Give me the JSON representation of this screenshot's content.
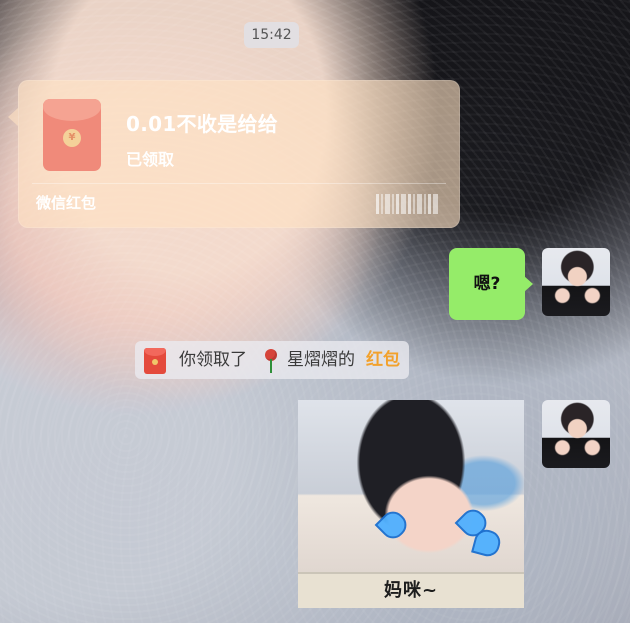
{
  "chat": {
    "timestamp": "15:42",
    "red_packet_card": {
      "title": "0.01不收是给给",
      "status": "已领取",
      "footer_label": "微信红包"
    },
    "messages": [
      {
        "type": "text",
        "text": "嗯?"
      },
      {
        "type": "system_notice",
        "text_prefix": "你领取了",
        "sender_name": "星熠熠的",
        "link_text": "红包"
      },
      {
        "type": "sticker",
        "caption": "妈咪~"
      }
    ]
  },
  "icons": {
    "red_packet": "red-packet-icon",
    "rose": "rose-icon",
    "avatar": "avatar"
  },
  "colors": {
    "green_bubble": "#95ec69",
    "link_orange": "#f2a12c"
  }
}
